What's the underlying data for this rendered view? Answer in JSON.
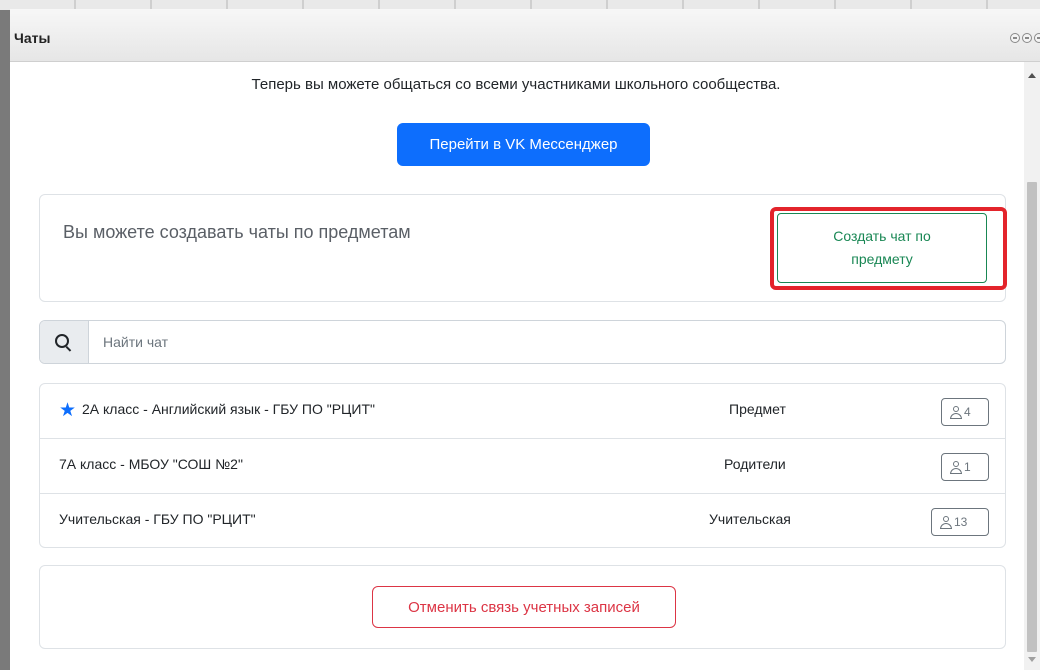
{
  "window": {
    "title": "Чаты"
  },
  "intro_text": "Теперь вы можете общаться со всеми участниками школьного сообщества.",
  "vk_button_label": "Перейти в VK Мессенджер",
  "subjects": {
    "text": "Вы можете создавать чаты по предметам",
    "create_button_label": "Создать чат по предмету"
  },
  "search": {
    "placeholder": "Найти чат",
    "value": ""
  },
  "chats": [
    {
      "name": "2А класс - Английский язык - ГБУ ПО \"РЦИТ\"",
      "type": "Предмет",
      "members": "4",
      "starred": true
    },
    {
      "name": "7А класс - МБОУ \"СОШ №2\"",
      "type": "Родители",
      "members": "1",
      "starred": false
    },
    {
      "name": "Учительская - ГБУ ПО \"РЦИТ\"",
      "type": "Учительская",
      "members": "13",
      "starred": false
    }
  ],
  "unlink_button_label": "Отменить связь учетных записей",
  "colors": {
    "primary": "#0d6efd",
    "success": "#198754",
    "danger": "#dc3545",
    "highlight": "#e3242b"
  },
  "icons": [
    "search-icon",
    "star-icon",
    "user-icon",
    "minimize-icon",
    "maximize-icon",
    "close-icon"
  ]
}
